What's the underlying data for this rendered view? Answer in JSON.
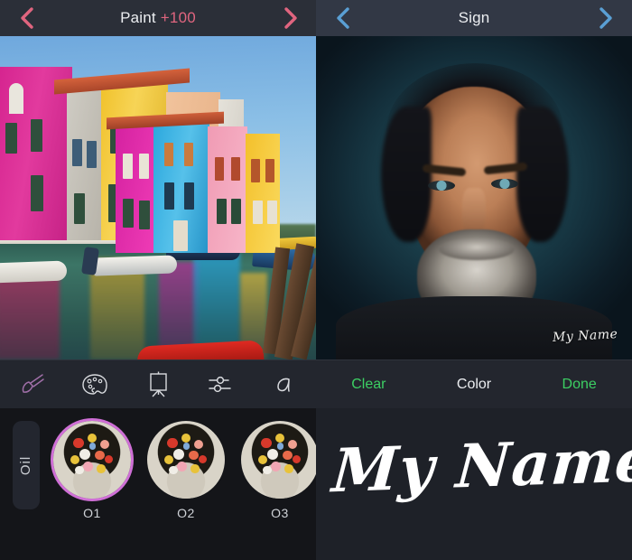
{
  "left_screen": {
    "header": {
      "back_icon": "chevron-left-icon",
      "forward_icon": "chevron-right-icon",
      "title": "Paint",
      "badge": "+100",
      "accent_color": "#e0657f"
    },
    "canvas": {
      "image_description": "Burano canal with colorful houses and boats"
    },
    "toolbar": {
      "items": [
        {
          "name": "brush-icon",
          "label": "Brush",
          "active": true,
          "color": "#a06fa8"
        },
        {
          "name": "palette-icon",
          "label": "Palette",
          "active": false,
          "color": "#d8dade"
        },
        {
          "name": "easel-icon",
          "label": "Canvas",
          "active": false,
          "color": "#d8dade"
        },
        {
          "name": "sliders-icon",
          "label": "Adjust",
          "active": false,
          "color": "#d8dade"
        },
        {
          "name": "text-icon",
          "label": "Text",
          "active": false,
          "color": "#d8dade"
        }
      ]
    },
    "presets": {
      "category_label": "Oil",
      "selected_index": 0,
      "selection_color": "#cf6fd6",
      "items": [
        {
          "label": "O1",
          "selected": true
        },
        {
          "label": "O2",
          "selected": false
        },
        {
          "label": "O3",
          "selected": false
        }
      ]
    }
  },
  "right_screen": {
    "header": {
      "back_icon": "chevron-left-icon",
      "forward_icon": "chevron-right-icon",
      "title": "Sign",
      "accent_color": "#5a9fd4"
    },
    "canvas": {
      "image_description": "Painterly portrait of a bearded man",
      "signature_overlay": "My Name"
    },
    "toolbar": {
      "clear_label": "Clear",
      "color_label": "Color",
      "done_label": "Done",
      "action_color": "#3ccf63",
      "neutral_color": "#eceef1"
    },
    "signature_pad": {
      "value": "My Name"
    }
  }
}
